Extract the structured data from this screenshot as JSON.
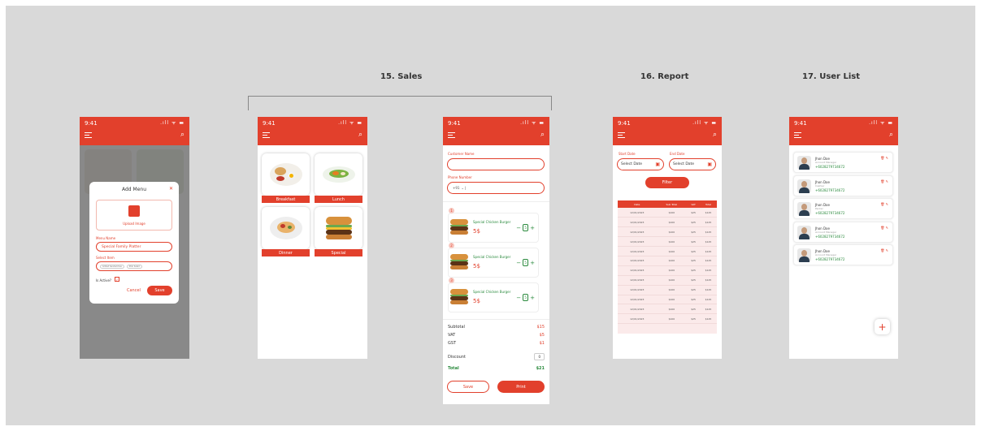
{
  "status": {
    "time": "9:41",
    "signal": ".ıll ᯤ ▬"
  },
  "titles": {
    "sales": "15. Sales",
    "report": "16. Report",
    "user_list": "17. User List"
  },
  "add_menu": {
    "title": "Add Menu",
    "upload_label": "Upload Image",
    "menu_name_label": "Menu Name",
    "menu_name_value": "Special Family Platter",
    "select_item_label": "Select Item",
    "chips": [
      "Grilled Sandwiches",
      "Pink Salad"
    ],
    "is_active_label": "Is Active?",
    "cancel": "Cancel",
    "save": "Save"
  },
  "categories": [
    "Breakfast",
    "Lunch",
    "Dinner",
    "Special"
  ],
  "order": {
    "customer_label": "Customer Name",
    "phone_label": "Phone Number",
    "phone_code": "+91",
    "items": [
      {
        "badge": "1",
        "name": "Special Chicken Burger",
        "price": "5$",
        "qty": "5"
      },
      {
        "badge": "2",
        "name": "Special Chicken Burger",
        "price": "5$",
        "qty": "5"
      },
      {
        "badge": "3",
        "name": "Special Chicken Burger",
        "price": "5$",
        "qty": "5"
      }
    ],
    "summary": [
      {
        "label": "Subtotal",
        "value": "$15"
      },
      {
        "label": "VAT",
        "value": "$5"
      },
      {
        "label": "GST",
        "value": "$1"
      }
    ],
    "discount_label": "Discount",
    "discount_value": "0",
    "total_label": "Total",
    "total_value": "$21",
    "save": "Save",
    "print": "Print"
  },
  "report": {
    "start_label": "Start Date",
    "end_label": "End Date",
    "start_value": "Select Date",
    "end_value": "Select Date",
    "filter": "Filter",
    "columns": [
      "Date",
      "Sub Total",
      "VAT",
      "Total"
    ],
    "rows": [
      [
        "12/01/2023",
        "$100",
        "$25",
        "$125"
      ],
      [
        "12/01/2023",
        "$100",
        "$25",
        "$125"
      ],
      [
        "12/01/2023",
        "$100",
        "$25",
        "$125"
      ],
      [
        "12/01/2023",
        "$100",
        "$25",
        "$125"
      ],
      [
        "12/01/2023",
        "$100",
        "$25",
        "$125"
      ],
      [
        "12/01/2023",
        "$100",
        "$25",
        "$125"
      ],
      [
        "12/01/2023",
        "$100",
        "$25",
        "$125"
      ],
      [
        "12/01/2023",
        "$100",
        "$25",
        "$125"
      ],
      [
        "12/01/2023",
        "$100",
        "$25",
        "$125"
      ],
      [
        "12/01/2023",
        "$100",
        "$25",
        "$125"
      ],
      [
        "12/01/2023",
        "$100",
        "$25",
        "$125"
      ],
      [
        "12/01/2023",
        "$100",
        "$25",
        "$125"
      ]
    ]
  },
  "users": [
    {
      "name": "Jhon Doe",
      "role": "Account Manager",
      "phone": "+6028279734672"
    },
    {
      "name": "Jhon Doe",
      "role": "Cashier",
      "phone": "+6028279734672"
    },
    {
      "name": "Jhon Doe",
      "role": "Packer",
      "phone": "+6028279734672"
    },
    {
      "name": "Jhon Doe",
      "role": "Account Manager",
      "phone": "+6028279734672"
    },
    {
      "name": "Jhon Doe",
      "role": "Account Manager",
      "phone": "+6028279734672"
    }
  ],
  "fab": "+",
  "colors": {
    "accent": "#e2402c",
    "green": "#2a8a3d",
    "canvas": "#d9d9d9"
  }
}
